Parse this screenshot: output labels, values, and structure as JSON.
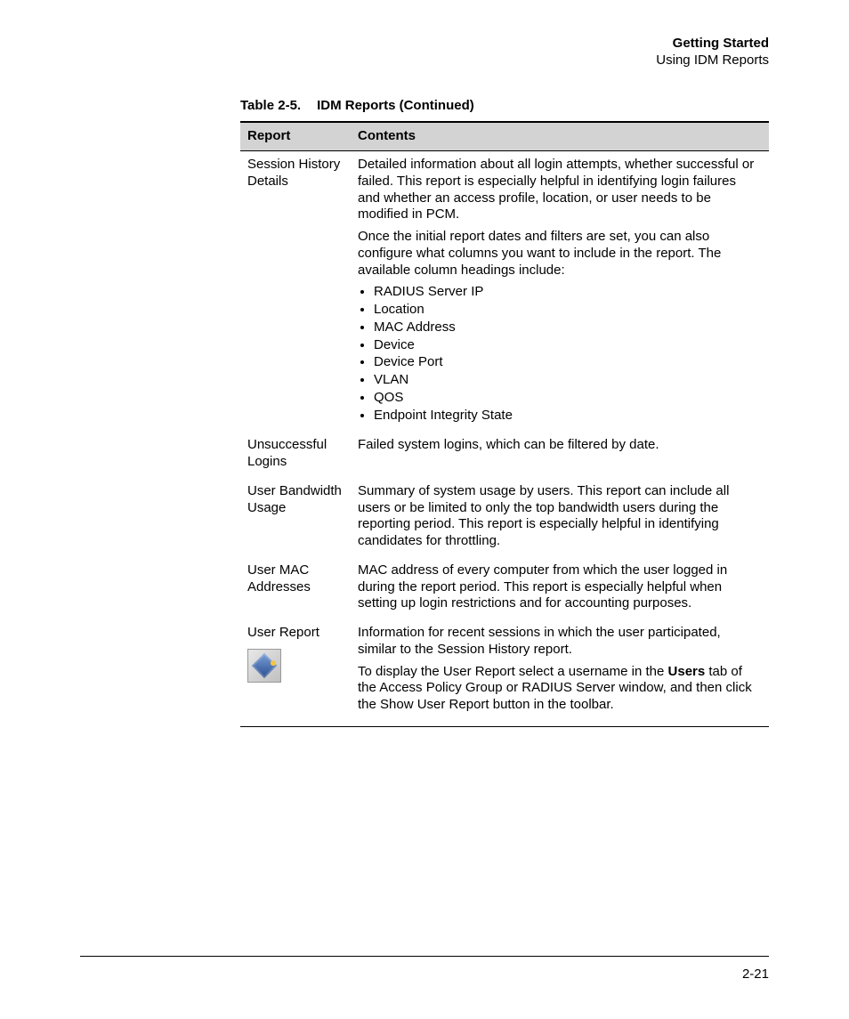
{
  "header": {
    "chapter": "Getting Started",
    "section": "Using IDM Reports"
  },
  "caption": {
    "number": "Table 2-5.",
    "title": "IDM Reports (Continued)"
  },
  "tableHeaders": {
    "col1": "Report",
    "col2": "Contents"
  },
  "rows": {
    "sessionHistory": {
      "name": "Session History Details",
      "p1": "Detailed information about all login attempts, whether successful or failed. This report is especially helpful in identifying login failures and whether an access profile, location, or user needs to be modified in PCM.",
      "p2": "Once the initial report dates and filters are set, you can also configure what columns you want to include in the report. The available column headings include:",
      "bullets": {
        "b1": "RADIUS Server IP",
        "b2": "Location",
        "b3": "MAC Address",
        "b4": "Device",
        "b5": "Device Port",
        "b6": "VLAN",
        "b7": "QOS",
        "b8": "Endpoint Integrity State"
      }
    },
    "unsuccessful": {
      "name": "Unsuccessful Logins",
      "p1": "Failed system logins, which can be filtered by date."
    },
    "bandwidth": {
      "name": "User Bandwidth Usage",
      "p1": "Summary of system usage by users. This report can include all users or be limited to only the top bandwidth users during the reporting period. This report is especially helpful in identifying candidates for throttling."
    },
    "mac": {
      "name": "User MAC Addresses",
      "p1": "MAC address of every computer from which the user logged in during the report period. This report is especially helpful when setting up login restrictions and for accounting purposes."
    },
    "userReport": {
      "name": "User Report",
      "p1": "Information for recent sessions in which the user participated, similar to the Session History report.",
      "p2a": "To display the User Report select a username in the ",
      "p2bold": "Users",
      "p2b": " tab of the Access Policy Group or RADIUS Server window, and then click the Show User Report button in the toolbar."
    }
  },
  "pageNumber": "2-21"
}
